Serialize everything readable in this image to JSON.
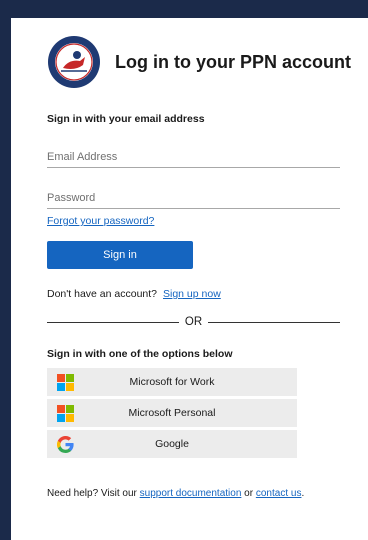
{
  "header": {
    "title": "Log in to your PPN account",
    "logo_text": "PEDIATRIC PANDEMIC NETWORK"
  },
  "email_section": {
    "heading": "Sign in with your email address",
    "email_placeholder": "Email Address",
    "password_placeholder": "Password",
    "forgot_link": "Forgot your password?",
    "signin_button": "Sign in"
  },
  "signup": {
    "prompt": "Don't have an account?",
    "link": "Sign up now"
  },
  "divider_text": "OR",
  "options": {
    "heading": "Sign in with one of the options below",
    "items": [
      {
        "label": "Microsoft for Work",
        "icon": "microsoft-icon"
      },
      {
        "label": "Microsoft Personal",
        "icon": "microsoft-icon"
      },
      {
        "label": "Google",
        "icon": "google-icon"
      }
    ]
  },
  "help": {
    "prefix": "Need help? Visit our",
    "support_link": "support documentation",
    "middle": "or",
    "contact_link": "contact us",
    "suffix": "."
  },
  "colors": {
    "background": "#1b2a4a",
    "accent": "#1565c0",
    "option_bg": "#ececec",
    "ms_red": "#f25022",
    "ms_green": "#7fba00",
    "ms_blue": "#00a4ef",
    "ms_yellow": "#ffb900"
  }
}
